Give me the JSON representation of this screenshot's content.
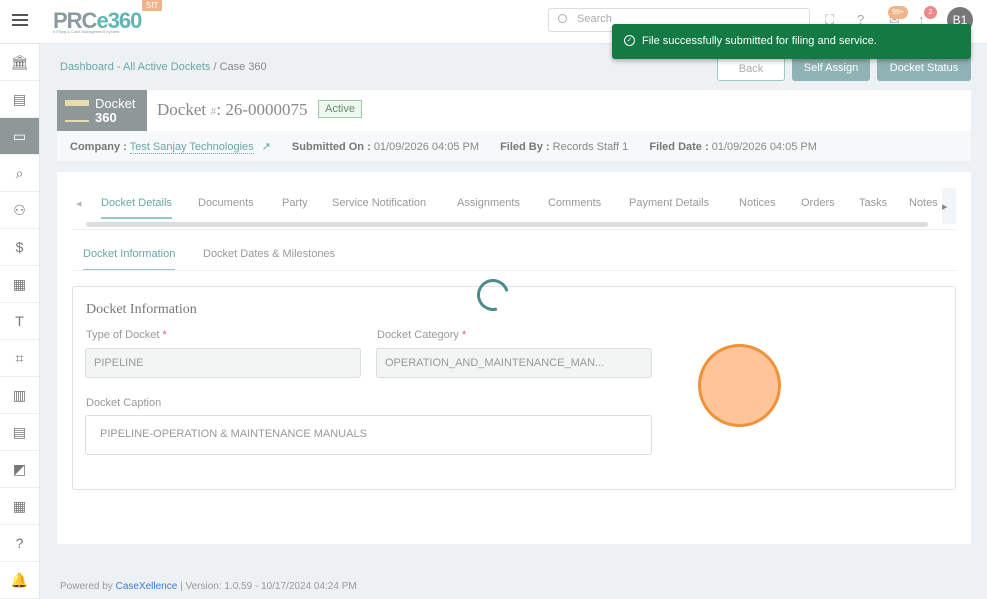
{
  "app": {
    "logo": "PRCe360",
    "logo_sub": "e-Filing & Case Management System",
    "env": "SIT"
  },
  "topbar": {
    "search_placeholder": "Search",
    "notif_count": "99+",
    "alert_count": "2",
    "avatar": "B1"
  },
  "toast": {
    "message": "File successfully submitted for filing and service."
  },
  "breadcrumb": {
    "link": "Dashboard - All Active Dockets",
    "current": "/ Case 360"
  },
  "actions": {
    "back": "Back",
    "self_assign": "Self Assign",
    "docket_status": "Docket Status"
  },
  "docket": {
    "box_line1": "Docket",
    "box_line2": "360",
    "title": "Docket",
    "hash": "#",
    "number": ": 26-0000075",
    "status": "Active"
  },
  "meta": {
    "company_label": "Company :",
    "company": "Test Sanjay Technologies",
    "submitted_label": "Submitted On :",
    "submitted": "01/09/2026 04:05 PM",
    "filed_by_label": "Filed By :",
    "filed_by": "Records Staff 1",
    "filed_date_label": "Filed Date :",
    "filed_date": "01/09/2026 04:05 PM"
  },
  "tabs": [
    "Docket Details",
    "Documents",
    "Party",
    "Service Notification",
    "Assignments",
    "Comments",
    "Payment Details",
    "Notices",
    "Orders",
    "Tasks",
    "Notes"
  ],
  "subtabs": [
    "Docket Information",
    "Docket Dates & Milestones"
  ],
  "form": {
    "title": "Docket Information",
    "type_label": "Type of Docket",
    "type_value": "PIPELINE",
    "category_label": "Docket Category",
    "category_value": "OPERATION_AND_MAINTENANCE_MAN...",
    "caption_label": "Docket Caption",
    "caption_value": "PIPELINE-OPERATION & MAINTENANCE MANUALS",
    "required": "*"
  },
  "footer": {
    "powered": "Powered by",
    "brand": "CaseXellence",
    "version": "|  Version: 1.0.59 - 10/17/2024 04:24 PM"
  }
}
